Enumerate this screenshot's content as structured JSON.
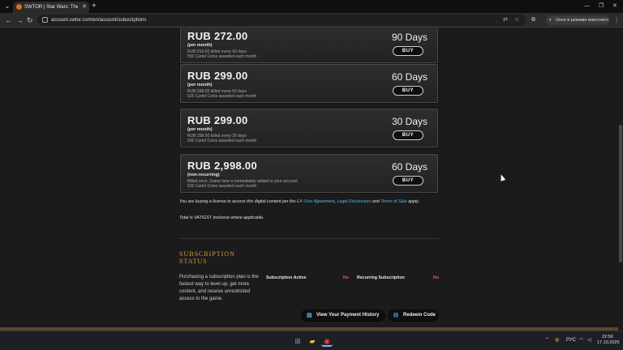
{
  "browser": {
    "tab_title": "SWTOR | Star Wars: The Old Re",
    "url": "account.swtor.com/en/account/subscriptions",
    "profile_label": "Окно в режиме инкогнито"
  },
  "plans": [
    {
      "price": "RUB 272.00",
      "period": "(per month)",
      "line1": "RUB 816.00 billed every 90 days",
      "line2": "550 Cartel Coins awarded each month",
      "days": "90 Days",
      "buy_label": "BUY"
    },
    {
      "price": "RUB 299.00",
      "period": "(per month)",
      "line1": "RUB 598.00 billed every 60 days",
      "line2": "525 Cartel Coins awarded each month",
      "days": "60 Days",
      "buy_label": "BUY"
    },
    {
      "price": "RUB 299.00",
      "period": "(per month)",
      "line1": "RUB 299.00 billed every 30 days",
      "line2": "500 Cartel Coins awarded each month",
      "days": "30 Days",
      "buy_label": "BUY"
    },
    {
      "price": "RUB 2,998.00",
      "period": "(non-recurring)",
      "line1": "Billed once. Game time is immediately added to your account",
      "line2": "525 Cartel Coins awarded each month",
      "days": "60 Days",
      "buy_label": "BUY"
    }
  ],
  "legal": {
    "prefix": "You are buying a license to access this digital content per the",
    "link1": "EA User Agreement",
    "sep": ",",
    "link2": "Legal Disclosures",
    "and": "and",
    "link3": "Terms of Sale",
    "suffix": "apply.",
    "vat": "Total is VAT/GST inclusive where applicable."
  },
  "subscription_status": {
    "title": "SUBSCRIPTION STATUS",
    "description": "Purchasing a subscription plan is the fastest way to level up, get more content, and receive unrestricted access to the game.",
    "active_label": "Subscription Active",
    "active_value": "No",
    "recurring_label": "Recurring Subscription",
    "recurring_value": "No"
  },
  "actions": {
    "payment_history": "View Your Payment History",
    "redeem_code": "Redeem Code"
  },
  "taskbar": {
    "language": "РУС",
    "time": "22:50",
    "date": "17.10.2025"
  }
}
